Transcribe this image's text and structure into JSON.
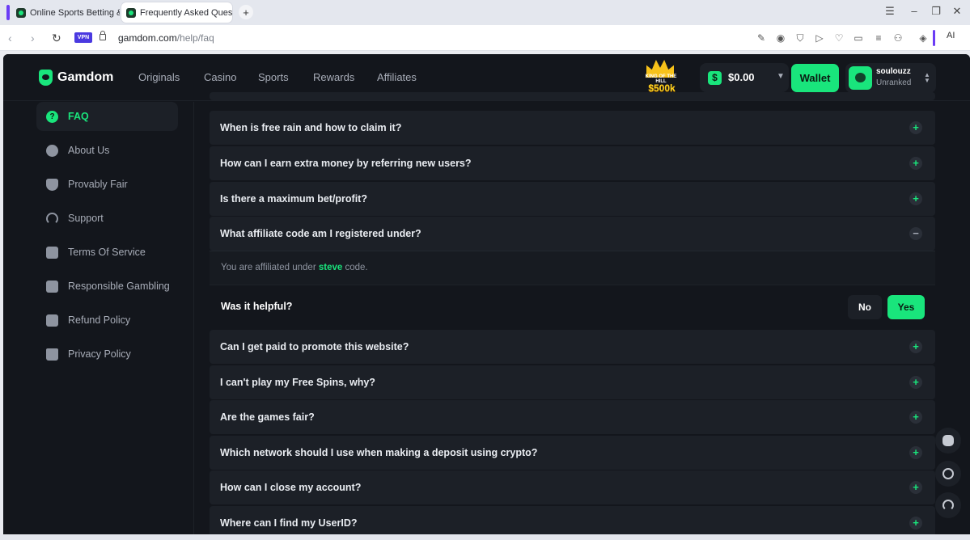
{
  "browser": {
    "tabs": [
      {
        "label": "Online Sports Betting & C"
      },
      {
        "label": "Frequently Asked Questio"
      }
    ],
    "vpn_label": "VPN",
    "url_host": "gamdom.com",
    "url_path": "/help/faq",
    "ai_label": "AI",
    "new_tab": "+"
  },
  "header": {
    "logo_text": "Gamdom",
    "nav": [
      "Originals",
      "Casino",
      "Sports",
      "Rewards",
      "Affiliates"
    ],
    "promo_top": "KING OF THE HILL",
    "promo_amount": "$500k",
    "balance_symbol": "$",
    "balance": "$0.00",
    "wallet_label": "Wallet",
    "username": "soulouzz",
    "rank": "Unranked"
  },
  "sidebar": {
    "items": [
      {
        "label": "FAQ",
        "icon": "question-icon",
        "active": true
      },
      {
        "label": "About Us",
        "icon": "paw-icon"
      },
      {
        "label": "Provably Fair",
        "icon": "shield-icon"
      },
      {
        "label": "Support",
        "icon": "headset-icon"
      },
      {
        "label": "Terms Of Service",
        "icon": "document-icon"
      },
      {
        "label": "Responsible Gambling",
        "icon": "dice-icon"
      },
      {
        "label": "Refund Policy",
        "icon": "refund-icon"
      },
      {
        "label": "Privacy Policy",
        "icon": "lock-icon"
      }
    ]
  },
  "faq": {
    "items": [
      {
        "q": "When is free rain and how to claim it?"
      },
      {
        "q": "How can I earn extra money by referring new users?"
      },
      {
        "q": "Is there a maximum bet/profit?"
      },
      {
        "q": "What affiliate code am I registered under?",
        "expanded": true
      },
      {
        "q": "Can I get paid to promote this website?"
      },
      {
        "q": "I can't play my Free Spins, why?"
      },
      {
        "q": "Are the games fair?"
      },
      {
        "q": "Which network should I use when making a deposit using crypto?"
      },
      {
        "q": "How can I close my account?"
      },
      {
        "q": "Where can I find my UserID?"
      }
    ],
    "answer_prefix": "You are affiliated under ",
    "answer_code": "steve",
    "answer_suffix": " code.",
    "helpful_question": "Was it helpful?",
    "no_label": "No",
    "yes_label": "Yes",
    "toggle_plus": "+",
    "toggle_minus": "−"
  },
  "colors": {
    "accent": "#19e57c",
    "background": "#13161c",
    "panel": "#1c2027"
  }
}
